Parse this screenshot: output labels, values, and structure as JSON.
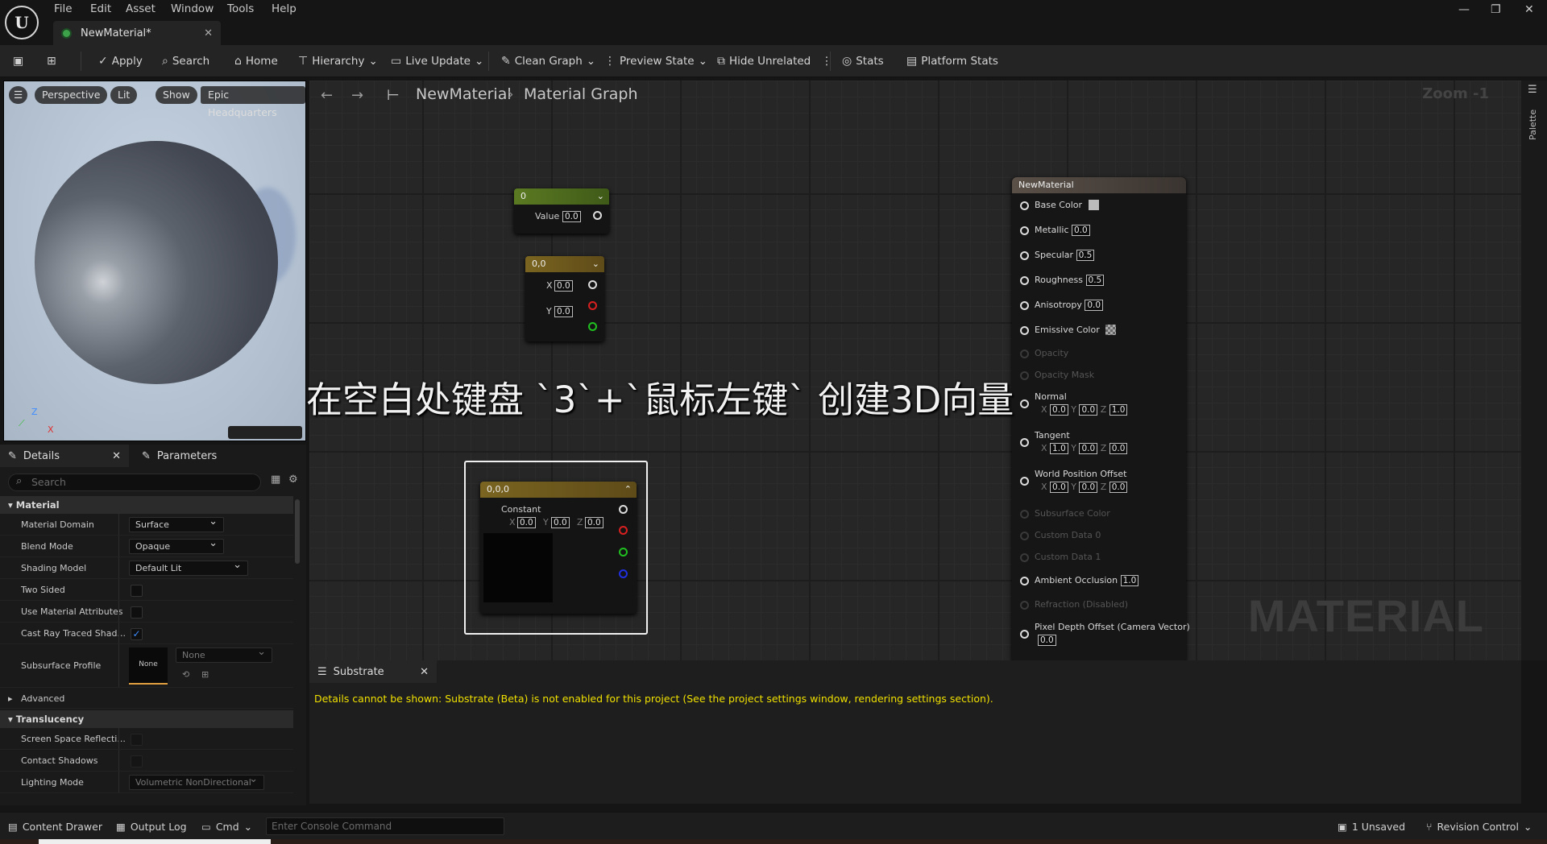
{
  "app": {
    "logo": "U",
    "menu": [
      "File",
      "Edit",
      "Asset",
      "Window",
      "Tools",
      "Help"
    ],
    "tab_title": "NewMaterial*"
  },
  "window_controls": {
    "minimize": "—",
    "restore": "❐",
    "close": "✕"
  },
  "toolbar": {
    "apply": "Apply",
    "search": "Search",
    "home": "Home",
    "hierarchy": "Hierarchy",
    "live_update": "Live Update",
    "clean_graph": "Clean Graph",
    "preview_state": "Preview State",
    "hide_unrelated": "Hide Unrelated",
    "stats": "Stats",
    "platform_stats": "Platform Stats"
  },
  "viewport": {
    "perspective": "Perspective",
    "lit": "Lit",
    "show": "Show",
    "level": "Epic Headquarters",
    "axis_z": "Z",
    "axis_x": "X"
  },
  "details": {
    "tab": "Details",
    "params_tab": "Parameters",
    "search_placeholder": "Search",
    "cat_material": "Material",
    "rows": [
      {
        "label": "Material Domain",
        "value": "Surface"
      },
      {
        "label": "Blend Mode",
        "value": "Opaque"
      },
      {
        "label": "Shading Model",
        "value": "Default Lit"
      },
      {
        "label": "Two Sided",
        "checked": false
      },
      {
        "label": "Use Material Attributes",
        "checked": false
      },
      {
        "label": "Cast Ray Traced Shad...",
        "checked": true
      }
    ],
    "subsurface_label": "Subsurface Profile",
    "subsurface_thumb": "None",
    "subsurface_value": "None",
    "advanced": "Advanced",
    "cat_translucency": "Translucency",
    "trans_rows": [
      {
        "label": "Screen Space Reflecti..."
      },
      {
        "label": "Contact Shadows"
      }
    ],
    "lighting_label": "Lighting Mode",
    "lighting_value": "Volumetric NonDirectional"
  },
  "graph": {
    "breadcrumb_root": "NewMaterial",
    "breadcrumb_child": "Material Graph",
    "zoom": "Zoom -1",
    "watermark": "MATERIAL",
    "palette": "Palette",
    "caption": "在空白处键盘 `3`+`鼠标左键` 创建3D向量",
    "node_scalar": {
      "title": "0",
      "label": "Value",
      "value": "0.0"
    },
    "node_vec2": {
      "title": "0,0",
      "x_label": "X",
      "x": "0.0",
      "y_label": "Y",
      "y": "0.0"
    },
    "node_vec3": {
      "title": "0,0,0",
      "label": "Constant",
      "x_label": "X",
      "x": "0.0",
      "y_label": "Y",
      "y": "0.0",
      "z_label": "Z",
      "z": "0.0"
    },
    "material_node": {
      "title": "NewMaterial",
      "base_color": "Base Color",
      "metallic": "Metallic",
      "metallic_v": "0.0",
      "specular": "Specular",
      "specular_v": "0.5",
      "roughness": "Roughness",
      "roughness_v": "0.5",
      "anisotropy": "Anisotropy",
      "anisotropy_v": "0.0",
      "emissive": "Emissive Color",
      "opacity": "Opacity",
      "opacity_mask": "Opacity Mask",
      "normal": "Normal",
      "normal_x": "0.0",
      "normal_y": "0.0",
      "normal_z": "1.0",
      "tangent": "Tangent",
      "tangent_x": "1.0",
      "tangent_y": "0.0",
      "tangent_z": "0.0",
      "wpo": "World Position Offset",
      "wpo_x": "0.0",
      "wpo_y": "0.0",
      "wpo_z": "0.0",
      "x_label": "X",
      "y_label": "Y",
      "z_label": "Z",
      "subsurface": "Subsurface Color",
      "custom0": "Custom Data 0",
      "custom1": "Custom Data 1",
      "ao": "Ambient Occlusion",
      "ao_v": "1.0",
      "refraction": "Refraction (Disabled)",
      "pdo": "Pixel Depth Offset (Camera Vector)",
      "pdo_v": "0.0"
    }
  },
  "substrate": {
    "tab": "Substrate",
    "message": "Details cannot be shown: Substrate (Beta) is not enabled for this project (See the project settings window, rendering settings section)."
  },
  "status": {
    "content_drawer": "Content Drawer",
    "output_log": "Output Log",
    "cmd": "Cmd",
    "console_placeholder": "Enter Console Command",
    "unsaved": "1 Unsaved",
    "revision": "Revision Control"
  },
  "colors": {
    "accent": "#3d8cff",
    "scalar_header": "#5b7a22",
    "vector_header": "#7a6420",
    "message": "#f0e000"
  }
}
